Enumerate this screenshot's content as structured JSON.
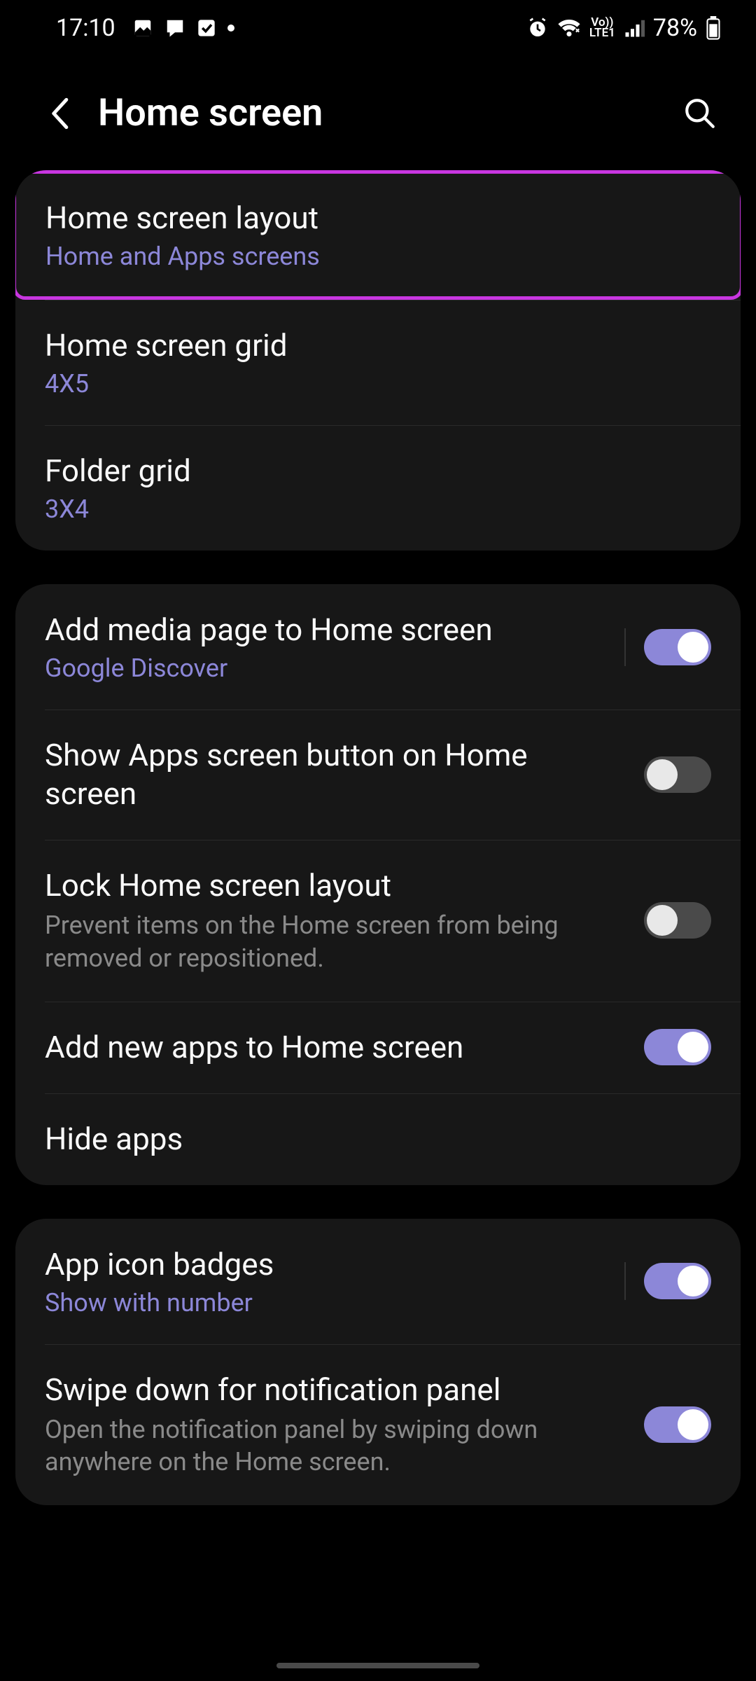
{
  "status": {
    "time": "17:10",
    "battery": "78%"
  },
  "header": {
    "title": "Home screen"
  },
  "group1": {
    "layout": {
      "title": "Home screen layout",
      "sub": "Home and Apps screens"
    },
    "grid": {
      "title": "Home screen grid",
      "sub": "4X5"
    },
    "folder": {
      "title": "Folder grid",
      "sub": "3X4"
    }
  },
  "group2": {
    "media": {
      "title": "Add media page to Home screen",
      "sub": "Google Discover",
      "on": true
    },
    "appsbtn": {
      "title": "Show Apps screen button on Home screen",
      "on": false
    },
    "lock": {
      "title": "Lock Home screen layout",
      "sub": "Prevent items on the Home screen from being removed or repositioned.",
      "on": false
    },
    "addnew": {
      "title": "Add new apps to Home screen",
      "on": true
    },
    "hide": {
      "title": "Hide apps"
    }
  },
  "group3": {
    "badges": {
      "title": "App icon badges",
      "sub": "Show with number",
      "on": true
    },
    "swipe": {
      "title": "Swipe down for notification panel",
      "sub": "Open the notification panel by swiping down anywhere on the Home screen.",
      "on": true
    }
  }
}
